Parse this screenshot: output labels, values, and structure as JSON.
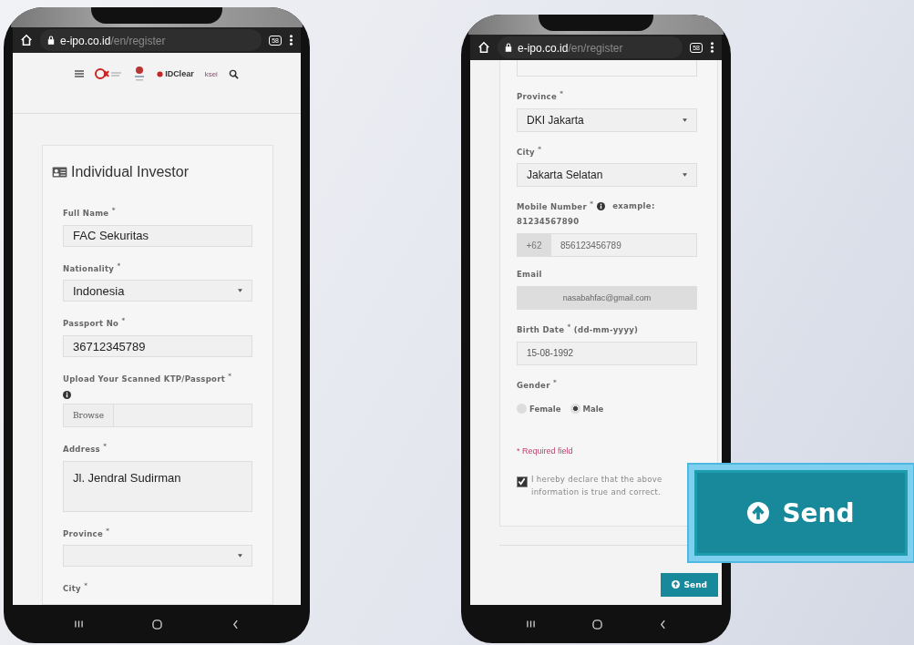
{
  "phones": [
    {
      "browser": {
        "host": "e-ipo.co.id",
        "path": "/en/register",
        "tab_count": "58"
      },
      "header": {
        "logos": [
          "IDClear",
          "ksei"
        ]
      },
      "form": {
        "title": "Individual Investor",
        "fields": [
          {
            "kind": "text",
            "label": "Full Name $^{*}$",
            "value": "FAC Sekuritas"
          },
          {
            "kind": "select",
            "label": "Nationality $^{*}$",
            "value": "Indonesia"
          },
          {
            "kind": "text",
            "label": "Passport No $^{*}$",
            "value": "36712345789"
          },
          {
            "kind": "file",
            "label": "Upload Your Scanned KTP/Passport $^{*}$",
            "button": "Browse"
          },
          {
            "kind": "textarea",
            "label": "Address $^{*}$",
            "value": "Jl. Jendral Sudirman"
          },
          {
            "kind": "select",
            "label": "Province $^{*}$"
          },
          {
            "kind": "label",
            "label": "City $^{*}$"
          }
        ]
      }
    },
    {
      "browser": {
        "host": "e-ipo.co.id",
        "path": "/en/register",
        "tab_count": "58"
      },
      "form": {
        "fields": [
          {
            "kind": "textarea_tail"
          },
          {
            "kind": "select",
            "label": "Province $^{*}$",
            "value": "DKI Jakarta"
          },
          {
            "kind": "select",
            "label": "City $^{*}$",
            "value": "Jakarta Selatan"
          },
          {
            "kind": "phone",
            "label": "Mobile Number $^{*}$",
            "hint": "example:",
            "example": "81234567890",
            "prefix": "+62",
            "value": "856123456789"
          },
          {
            "kind": "text",
            "label": "Email",
            "value": "nasabahfac@gmail.com",
            "disabled": true
          },
          {
            "kind": "text",
            "label": "Birth Date $^{*}$ (dd-mm-yyyy)",
            "value": "15-08-1992",
            "disabled": false
          },
          {
            "kind": "radio",
            "label": "Gender $^{*}$",
            "options": [
              {
                "label": "Female",
                "selected": false
              },
              {
                "label": "Male",
                "selected": true
              }
            ]
          },
          {
            "kind": "note",
            "label": "* Required field"
          },
          {
            "kind": "checkbox",
            "label": "I hereby declare that the above information is true and correct.",
            "checked": true
          }
        ]
      },
      "footer": {
        "button": "Send"
      }
    }
  ],
  "callout": {
    "label": "Send"
  }
}
